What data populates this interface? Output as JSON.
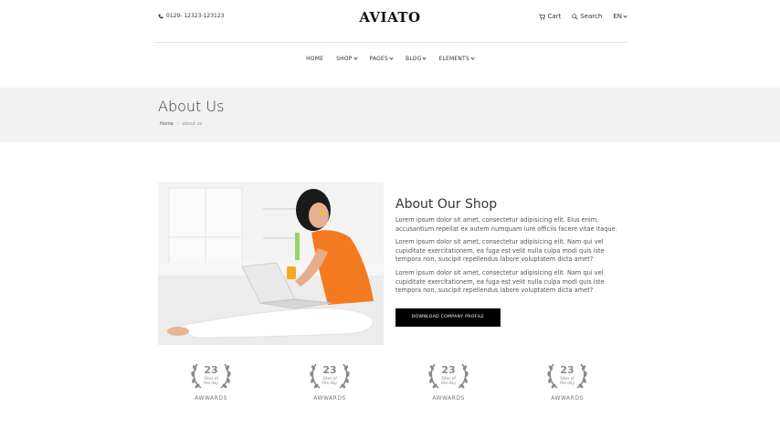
{
  "header": {
    "phone": "0129- 12323-123123",
    "logo": "AVIATO",
    "cart_label": "Cart",
    "search_label": "Search",
    "language": "EN"
  },
  "nav": {
    "items": [
      {
        "label": "HOME",
        "dropdown": false
      },
      {
        "label": "SHOP",
        "dropdown": true
      },
      {
        "label": "PAGES",
        "dropdown": true
      },
      {
        "label": "BLOG",
        "dropdown": true
      },
      {
        "label": "ELEMENTS",
        "dropdown": true
      }
    ]
  },
  "page_header": {
    "title": "About Us",
    "breadcrumb": {
      "home": "Home",
      "separator": "/",
      "current": "about us"
    }
  },
  "about": {
    "heading": "About Our Shop",
    "paragraphs": [
      "Lorem ipsum dolor sit amet, consectetur adipisicing elit. Eius enim, accusantium repellat ex autem numquam iure officiis facere vitae itaque.",
      "Lorem ipsum dolor sit amet, consectetur adipisicing elit. Nam qui vel cupiditate exercitationem, ea fuga est velit nulla culpa modi quis iste tempora non, suscipit repellendus labore voluptatem dicta amet?",
      "Lorem ipsum dolor sit amet, consectetur adipisicing elit. Nam qui vel cupiditate exercitationem, ea fuga est velit nulla culpa modi quis iste tempora non, suscipit repellendus labore voluptatem dicta amet?"
    ],
    "button_label": "DOWNLOAD COMPANY PROFILE"
  },
  "awards": [
    {
      "number": "23",
      "line1": "Sites of",
      "line2": "the day",
      "label": "AWWARDS"
    },
    {
      "number": "23",
      "line1": "Sites of",
      "line2": "the day",
      "label": "AWWARDS"
    },
    {
      "number": "23",
      "line1": "Sites of",
      "line2": "the day",
      "label": "AWWARDS"
    },
    {
      "number": "23",
      "line1": "Sites of",
      "line2": "the day",
      "label": "AWWARDS"
    }
  ],
  "colors": {
    "band": "#f2f2f2",
    "button": "#000000",
    "award_gray": "#8a8a8a",
    "shirt_orange": "#f47a20"
  }
}
